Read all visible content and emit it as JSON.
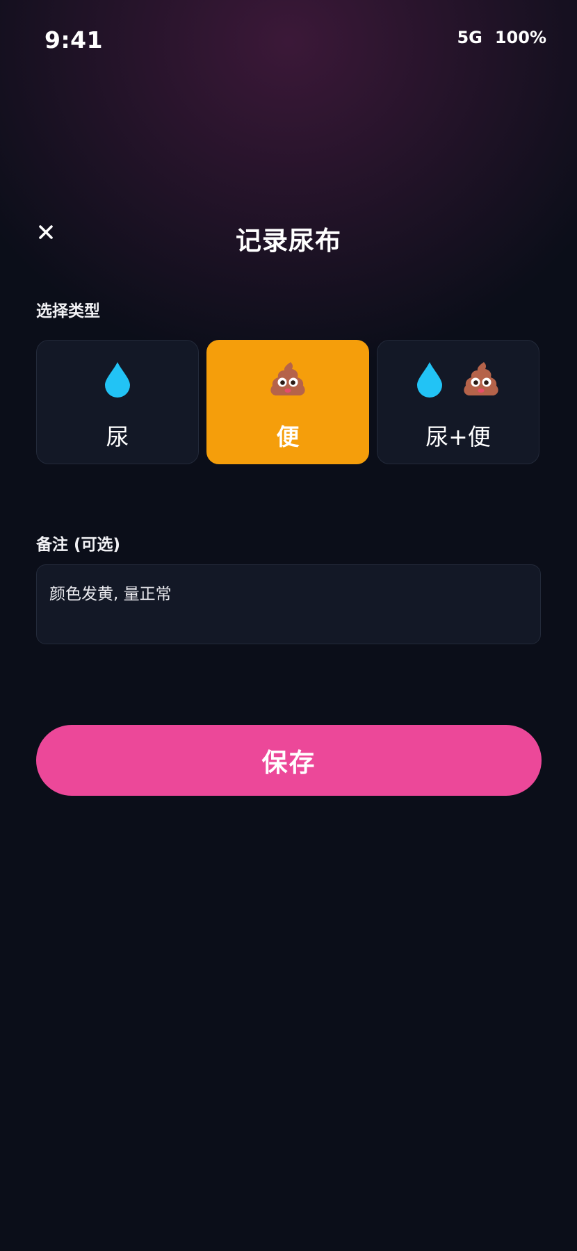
{
  "status_bar": {
    "time": "9:41",
    "network": "5G",
    "battery": "100%"
  },
  "header": {
    "close_icon": "close-icon",
    "title": "记录尿布"
  },
  "type_section": {
    "label": "选择类型",
    "options": [
      {
        "label": "尿",
        "icons": [
          "droplet-icon"
        ],
        "selected": false
      },
      {
        "label": "便",
        "icons": [
          "poop-icon"
        ],
        "selected": true
      },
      {
        "label": "尿+便",
        "icons": [
          "droplet-icon",
          "poop-icon"
        ],
        "selected": false
      }
    ]
  },
  "note_section": {
    "label": "备注 (可选)",
    "value": "颜色发黄, 量正常"
  },
  "save_button": {
    "label": "保存"
  },
  "colors": {
    "background": "#0b0e19",
    "card": "#131826",
    "selected": "#f59e0b",
    "accent": "#ec4899",
    "droplet": "#22c3f5",
    "poop": "#b5634a"
  }
}
